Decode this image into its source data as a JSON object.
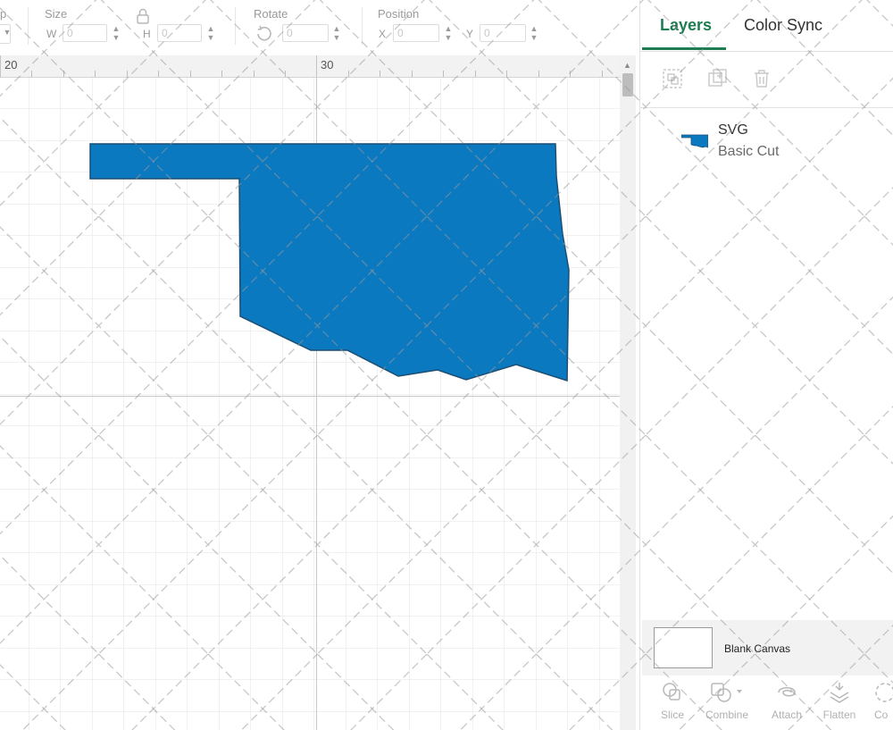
{
  "toolbar": {
    "partial_label": "p",
    "size_label": "Size",
    "w_letter": "W",
    "w_value": "0",
    "h_letter": "H",
    "h_value": "0",
    "rotate_label": "Rotate",
    "rotate_value": "0",
    "position_label": "Position",
    "x_letter": "X",
    "x_value": "0",
    "y_letter": "Y",
    "y_value": "0"
  },
  "ruler": {
    "labels": [
      "20",
      "30"
    ]
  },
  "panel": {
    "tabs": [
      {
        "label": "Layers",
        "active": true
      },
      {
        "label": "Color Sync",
        "active": false
      }
    ],
    "actions": [
      "group-icon",
      "duplicate-icon",
      "delete-icon"
    ],
    "layer": {
      "name": "SVG",
      "operation": "Basic Cut",
      "icon": "oklahoma-shape-thumbnail"
    },
    "canvas": {
      "label": "Blank Canvas"
    },
    "tools": [
      {
        "label": "Slice",
        "icon": "slice-icon"
      },
      {
        "label": "Combine",
        "icon": "combine-icon"
      },
      {
        "label": "Attach",
        "icon": "attach-icon"
      },
      {
        "label": "Flatten",
        "icon": "flatten-icon"
      },
      {
        "label": "Co",
        "icon": "contour-icon"
      }
    ]
  },
  "colors": {
    "accent": "#1e7c52",
    "shape_fill": "#0b79c0",
    "shape_stroke": "#1d4e72"
  }
}
